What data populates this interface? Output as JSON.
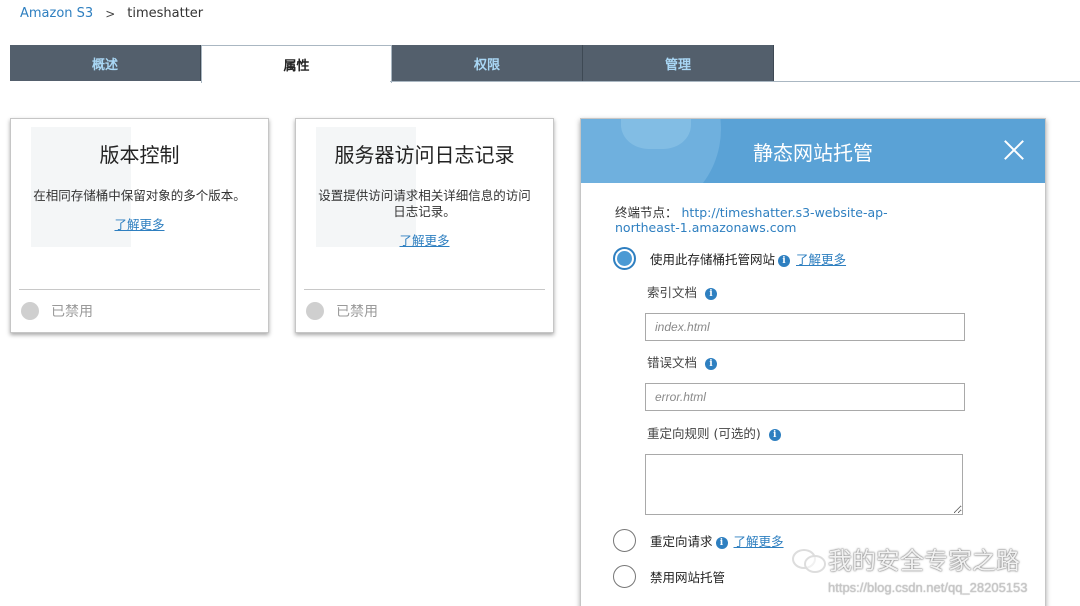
{
  "breadcrumb": {
    "root": "Amazon S3",
    "separator": ">",
    "current": "timeshatter"
  },
  "tabs": [
    {
      "label": "概述",
      "active": false
    },
    {
      "label": "属性",
      "active": true
    },
    {
      "label": "权限",
      "active": false
    },
    {
      "label": "管理",
      "active": false
    }
  ],
  "cards": {
    "versioning": {
      "title": "版本控制",
      "description": "在相同存储桶中保留对象的多个版本。",
      "learn_more": "了解更多",
      "status": "已禁用"
    },
    "logging": {
      "title": "服务器访问日志记录",
      "description": "设置提供访问请求相关详细信息的访问日志记录。",
      "learn_more": "了解更多",
      "status": "已禁用"
    }
  },
  "panel": {
    "title": "静态网站托管",
    "close_icon": "close-icon",
    "endpoint_label": "终端节点：",
    "endpoint_url": "http://timeshatter.s3-website-ap-northeast-1.amazonaws.com",
    "option_host": "使用此存储桶托管网站",
    "option_host_learn_more": "了解更多",
    "index_label": "索引文档",
    "index_placeholder": "index.html",
    "error_label": "错误文档",
    "error_placeholder": "error.html",
    "redirect_rules_label": "重定向规则 (可选的)",
    "option_redirect": "重定向请求",
    "option_redirect_learn_more": "了解更多",
    "option_disable": "禁用网站托管",
    "info_glyph": "i",
    "selected_option": "host"
  },
  "watermark": {
    "text": "我的安全专家之路",
    "url": "https://blog.csdn.net/qq_28205153"
  }
}
